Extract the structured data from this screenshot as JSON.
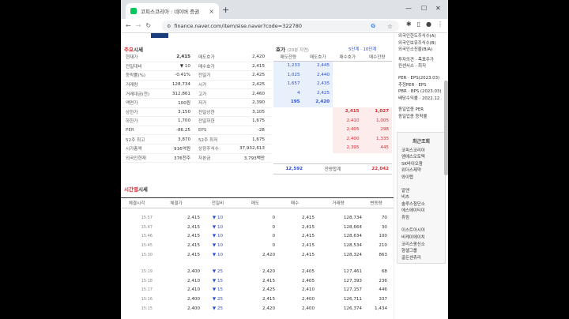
{
  "browser": {
    "tab_title": "코피스코리아 : 네이버 증권",
    "url": "finance.naver.com/item/sise.naver?code=322780"
  },
  "quote": {
    "section_title_a": "주요",
    "section_title_b": "시세",
    "rows": [
      {
        "l1": "현재가",
        "v1": "2,415",
        "l2": "매도호가",
        "v2": "2,420"
      },
      {
        "l1": "전일대비",
        "v1": "▼ 10",
        "l2": "매수호가",
        "v2": "2,415"
      },
      {
        "l1": "등락률(%)",
        "v1": "-0.41%",
        "l2": "전일가",
        "v2": "2,425"
      },
      {
        "l1": "거래량",
        "v1": "128,734",
        "l2": "시가",
        "v2": "2,425"
      },
      {
        "l1": "거래대금(천)",
        "v1": "312,861",
        "l2": "고가",
        "v2": "2,460"
      },
      {
        "l1": "액면가",
        "v1": "100원",
        "l2": "저가",
        "v2": "2,390"
      },
      {
        "l1": "상한가",
        "v1": "3,150",
        "l2": "전일상한",
        "v2": "3,105"
      },
      {
        "l1": "하한가",
        "v1": "1,700",
        "l2": "전일하한",
        "v2": "1,675"
      },
      {
        "l1": "PER",
        "v1": "-86.25",
        "l2": "EPS",
        "v2": "-28"
      },
      {
        "l1": "52주 최고",
        "v1": "3,870",
        "l2": "52주 최저",
        "v2": "1,675"
      },
      {
        "l1": "시가총액",
        "v1": "916억원",
        "l2": "상장주식수",
        "v2": "37,932,613"
      },
      {
        "l1": "외국인현재",
        "v1": "376천주",
        "l2": "자본금",
        "v2": "3,793백만"
      }
    ]
  },
  "hoga": {
    "title": "호가",
    "subtitle": "(20분 지연)",
    "tabs": "5단계 · 10단계",
    "headers": [
      "매도잔량",
      "매도호가",
      "매수호가",
      "매수잔량"
    ],
    "asks": [
      {
        "qty": "1,233",
        "price": "2,445"
      },
      {
        "qty": "1,025",
        "price": "2,440"
      },
      {
        "qty": "1,657",
        "price": "2,435"
      },
      {
        "qty": "4",
        "price": "2,425"
      },
      {
        "qty": "195",
        "price": "2,420"
      }
    ],
    "bids": [
      {
        "price": "2,415",
        "qty": "1,027"
      },
      {
        "price": "2,410",
        "qty": "1,005"
      },
      {
        "price": "2,405",
        "qty": "298"
      },
      {
        "price": "2,400",
        "qty": "1,335"
      },
      {
        "price": "2,395",
        "qty": "445"
      }
    ],
    "total_ask": "12,592",
    "total_label": "잔량합계",
    "total_bid": "22,042"
  },
  "timeline": {
    "section_title_a": "시간별",
    "section_title_b": "시세",
    "headers": [
      "체결시각",
      "체결가",
      "전일비",
      "매도",
      "매수",
      "거래량",
      "변동량"
    ],
    "group1": [
      {
        "t": "15:57",
        "p": "2,415",
        "d": "▼ 10",
        "s": "0",
        "b": "2,415",
        "v": "128,734",
        "c": "70"
      },
      {
        "t": "15:47",
        "p": "2,415",
        "d": "▼ 10",
        "s": "0",
        "b": "2,415",
        "v": "128,664",
        "c": "30"
      },
      {
        "t": "15:46",
        "p": "2,415",
        "d": "▼ 10",
        "s": "0",
        "b": "2,415",
        "v": "128,634",
        "c": "100"
      },
      {
        "t": "15:45",
        "p": "2,415",
        "d": "▼ 10",
        "s": "0",
        "b": "2,415",
        "v": "128,534",
        "c": "210"
      },
      {
        "t": "15:30",
        "p": "2,415",
        "d": "▼ 10",
        "s": "2,420",
        "b": "2,415",
        "v": "128,324",
        "c": "863"
      }
    ],
    "group2": [
      {
        "t": "15:19",
        "p": "2,400",
        "d": "▼ 25",
        "s": "2,420",
        "b": "2,405",
        "v": "127,461",
        "c": "68"
      },
      {
        "t": "15:18",
        "p": "2,410",
        "d": "▼ 15",
        "s": "2,415",
        "b": "2,405",
        "v": "127,393",
        "c": "236"
      },
      {
        "t": "15:17",
        "p": "2,410",
        "d": "▼ 15",
        "s": "2,425",
        "b": "2,410",
        "v": "127,157",
        "c": "446"
      },
      {
        "t": "15:16",
        "p": "2,400",
        "d": "▼ 25",
        "s": "2,415",
        "b": "2,400",
        "v": "126,711",
        "c": "337"
      },
      {
        "t": "15:15",
        "p": "2,400",
        "d": "▼ 25",
        "s": "2,420",
        "b": "2,400",
        "v": "126,374",
        "c": "1,434"
      }
    ]
  },
  "side": {
    "items_a": [
      "외국인한도주식수(A)",
      "외국인보유주식수(B)",
      "외국인소진율(B/A)"
    ],
    "items_b": [
      "투자의견 · 목표주가",
      "컨센서스 · 최저"
    ],
    "items_c": [
      "PER · EPS(2023.03)",
      "추정PER · EPS",
      "PBR · BPS (2023.03)",
      "배당수익률 · 2022.12"
    ],
    "items_d": [
      "동일업종 PER",
      "동일업종 등락률"
    ],
    "recent_head": "최근조회",
    "recent": [
      "코피스코리아",
      "엠에스오토텍",
      "SK바이오팜",
      "위더스제약",
      "와이랩"
    ],
    "recent_b": [
      "알엔",
      "비츠",
      "솔루스첨단소",
      "에스에이티이",
      "휴림"
    ],
    "recent_c": [
      "이스트아시아",
      "비케이에이치",
      "코리스팡신소",
      "형셀그룹",
      "골든센츄리"
    ]
  }
}
